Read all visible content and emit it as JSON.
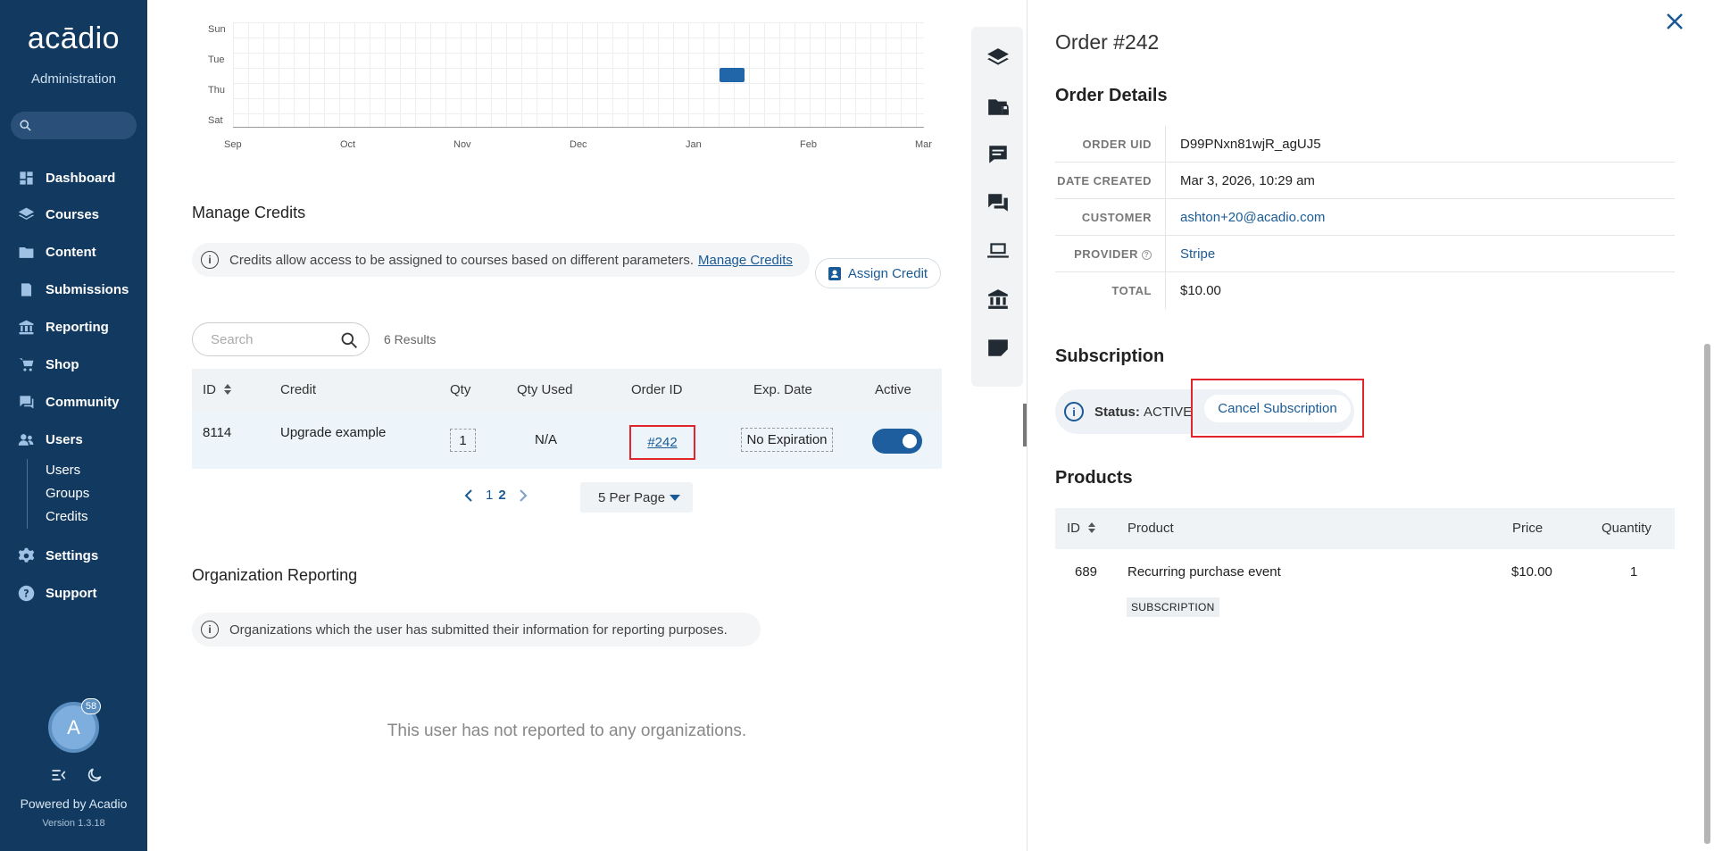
{
  "sidebar": {
    "logo": "acādio",
    "subtitle": "Administration",
    "nav": [
      {
        "label": "Dashboard",
        "icon": "dashboard-icon"
      },
      {
        "label": "Courses",
        "icon": "layers-icon"
      },
      {
        "label": "Content",
        "icon": "folder-icon"
      },
      {
        "label": "Submissions",
        "icon": "clipboard-icon"
      },
      {
        "label": "Reporting",
        "icon": "bank-icon"
      },
      {
        "label": "Shop",
        "icon": "cart-icon"
      },
      {
        "label": "Community",
        "icon": "chat-icon"
      },
      {
        "label": "Users",
        "icon": "users-icon"
      },
      {
        "label": "Settings",
        "icon": "gear-icon"
      },
      {
        "label": "Support",
        "icon": "help-icon"
      }
    ],
    "subnav": [
      "Users",
      "Groups",
      "Credits"
    ],
    "avatar_initial": "A",
    "notification_count": "58",
    "powered_by": "Powered by Acadio",
    "version": "Version 1.3.18"
  },
  "heatmap": {
    "days": [
      "Sun",
      "Tue",
      "Thu",
      "Sat"
    ],
    "months": [
      "Sep",
      "Oct",
      "Nov",
      "Dec",
      "Jan",
      "Feb",
      "Mar"
    ]
  },
  "credits": {
    "title": "Manage Credits",
    "info": "Credits allow access to be assigned to courses based on different parameters.",
    "info_link": "Manage Credits",
    "assign_button": "Assign Credit",
    "search_placeholder": "Search",
    "results": "6 Results",
    "columns": [
      "ID",
      "Credit",
      "Qty",
      "Qty Used",
      "Order ID",
      "Exp. Date",
      "Active"
    ],
    "row": {
      "id": "8114",
      "credit": "Upgrade example",
      "qty": "1",
      "qty_used": "N/A",
      "order_id": "#242",
      "exp": "No Expiration",
      "active": true
    },
    "pages": [
      "1",
      "2"
    ],
    "per_page": "5 Per Page"
  },
  "org_reporting": {
    "title": "Organization Reporting",
    "info": "Organizations which the user has submitted their information for reporting purposes.",
    "empty": "This user has not reported to any organizations."
  },
  "order_panel": {
    "title": "Order #242",
    "details_heading": "Order Details",
    "details": [
      {
        "label": "ORDER UID",
        "value": "D99PNxn81wjR_agUJ5"
      },
      {
        "label": "DATE CREATED",
        "value": "Mar 3, 2026, 10:29 am"
      },
      {
        "label": "CUSTOMER",
        "value": "ashton+20@acadio.com"
      },
      {
        "label": "PROVIDER",
        "value": "Stripe"
      },
      {
        "label": "TOTAL",
        "value": "$10.00"
      }
    ],
    "subscription_heading": "Subscription",
    "status_label": "Status:",
    "status_value": "ACTIVE",
    "cancel_button": "Cancel Subscription",
    "products_heading": "Products",
    "product_columns": [
      "ID",
      "Product",
      "Price",
      "Quantity"
    ],
    "product": {
      "id": "689",
      "name": "Recurring purchase event",
      "price": "$10.00",
      "quantity": "1",
      "tag": "SUBSCRIPTION"
    }
  },
  "colors": {
    "sidebar": "#123a60",
    "accent": "#1a5a96",
    "highlight": "#e0262b"
  }
}
